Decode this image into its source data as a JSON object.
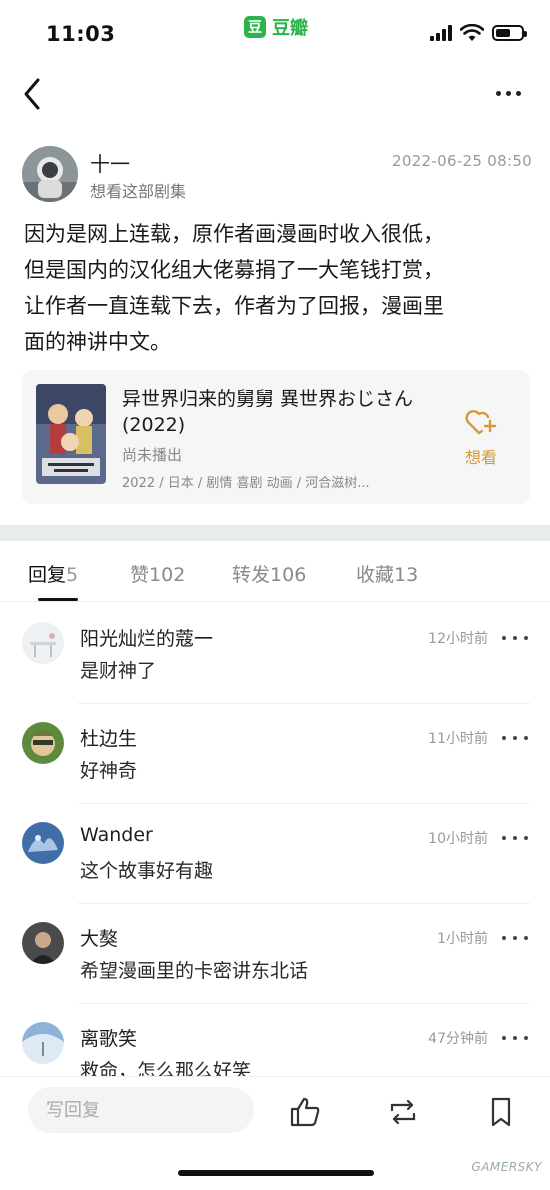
{
  "status_bar": {
    "time": "11:03",
    "app_logo": "豆",
    "app_name": "豆瓣",
    "icons": [
      "signal-icon",
      "wifi-icon",
      "battery-icon"
    ],
    "battery_level": 0.6
  },
  "nav": {
    "back_icon": "chevron-left-icon",
    "more_icon": "ellipsis-icon"
  },
  "post": {
    "author": "十一",
    "author_status": "想看这部剧集",
    "time": "2022-06-25 08:50",
    "lines": [
      "因为是网上连载，原作者画漫画时收入很低，",
      "但是国内的汉化组大佬募捐了一大笔钱打赏，",
      "让作者一直连载下去，作者为了回报，漫画里",
      "面的神讲中文。"
    ]
  },
  "subject_card": {
    "title": "异世界归来的舅舅 異世界おじさん (2022)",
    "status": "尚未播出",
    "meta": "2022 / 日本 / 剧情 喜剧 动画 / 河合滋树...",
    "want_label": "想看",
    "want_icon": "heart-plus-icon",
    "accent": "#d29a3c"
  },
  "tabs": [
    {
      "label": "回复",
      "count": "5",
      "active": true
    },
    {
      "label": "赞",
      "count": "102",
      "active": false
    },
    {
      "label": "转发",
      "count": "106",
      "active": false
    },
    {
      "label": "收藏",
      "count": "13",
      "active": false
    }
  ],
  "comments": [
    {
      "name": "阳光灿烂的蔻一",
      "text": "是财神了",
      "time": "12小时前"
    },
    {
      "name": "杜边生",
      "text": "好神奇",
      "time": "11小时前"
    },
    {
      "name": "Wander",
      "text": "这个故事好有趣",
      "time": "10小时前"
    },
    {
      "name": "大獒",
      "text": "希望漫画里的卡密讲东北话",
      "time": "1小时前"
    },
    {
      "name": "离歌笑",
      "text": "救命，怎么那么好笑",
      "time": "47分钟前"
    }
  ],
  "bottom_bar": {
    "reply_placeholder": "写回复",
    "icons": [
      "thumbs-up-icon",
      "repost-icon",
      "bookmark-icon"
    ]
  },
  "watermark": "GAMERSKY",
  "colors": {
    "brand": "#2cb34a",
    "divider": "#e9eeeb"
  }
}
